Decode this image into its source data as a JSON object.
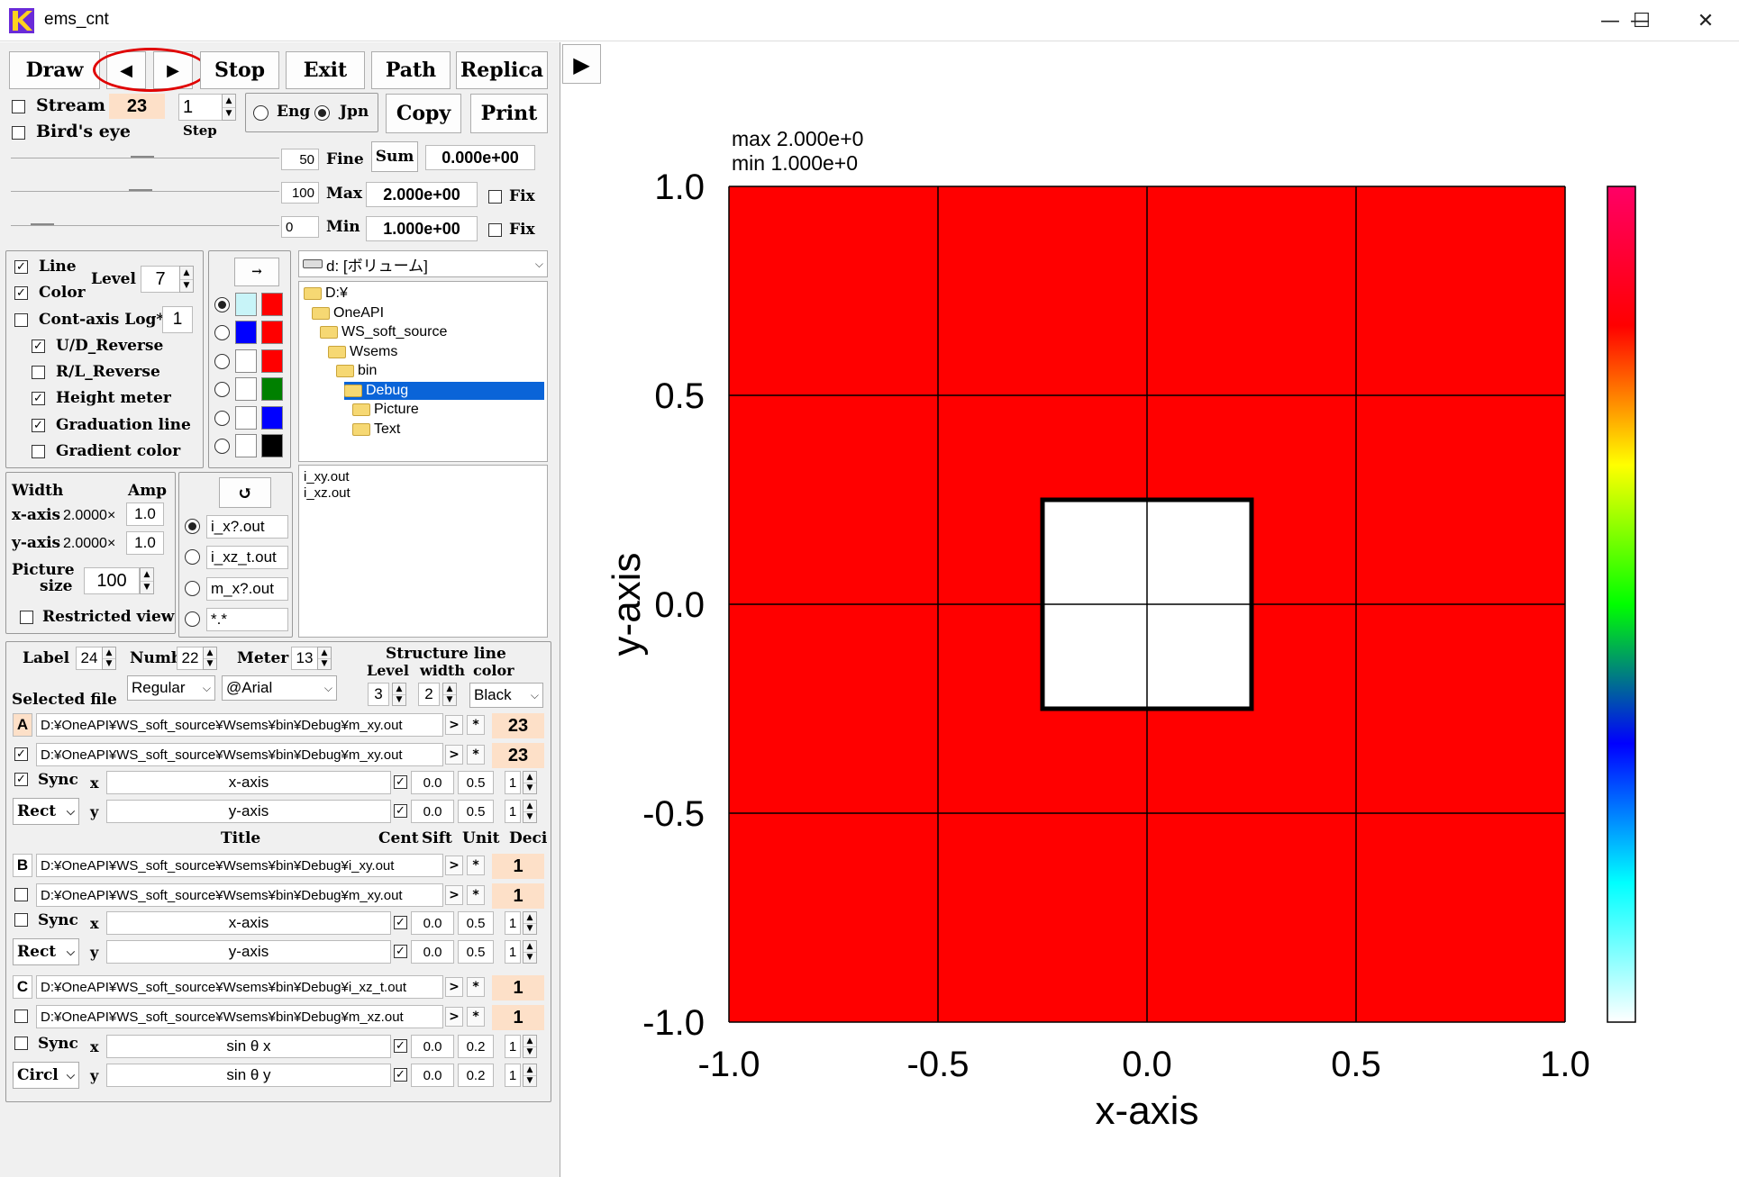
{
  "window": {
    "title": "ems_cnt",
    "minimize_icon": "—",
    "maximize_icon": "☐",
    "close_icon": "✕"
  },
  "toolbar": {
    "draw": "Draw",
    "prev": "◀",
    "next": "▶",
    "stop": "Stop",
    "exit": "Exit",
    "path": "Path",
    "replica": "Replica",
    "copy": "Copy",
    "print": "Print",
    "play": "▶"
  },
  "stream": {
    "label": "Stream",
    "value": "23",
    "step_value": "1",
    "step_label": "Step",
    "birds_eye": "Bird's eye"
  },
  "language": {
    "eng": "Eng",
    "jpn": "Jpn",
    "selected": "Jpn"
  },
  "range": {
    "fine_value": "50",
    "fine_label": "Fine",
    "sum_label": "Sum",
    "sum_value": "0.000e+00",
    "max_slider": "100",
    "max_label": "Max",
    "max_value": "2.000e+00",
    "max_fix": "Fix",
    "min_slider": "0",
    "min_label": "Min",
    "min_value": "1.000e+00",
    "min_fix": "Fix"
  },
  "options": {
    "line": "Line",
    "color": "Color",
    "level_label": "Level",
    "level_value": "7",
    "cont_axis": "Cont-axis Log*",
    "cont_axis_value": "1",
    "ud_reverse": "U/D_Reverse",
    "rl_reverse": "R/L_Reverse",
    "height_meter": "Height meter",
    "graduation_line": "Graduation line",
    "gradient_color": "Gradient color"
  },
  "palette": {
    "arrow": "→",
    "rows": [
      {
        "left": "#c8f4f8",
        "right": "#ff0000",
        "selected": true
      },
      {
        "left": "#0000ff",
        "right": "#ff0000",
        "selected": false
      },
      {
        "left": "#ffffff",
        "right": "#ff0000",
        "selected": false
      },
      {
        "left": "#ffffff",
        "right": "#008000",
        "selected": false
      },
      {
        "left": "#ffffff",
        "right": "#0000ff",
        "selected": false
      },
      {
        "left": "#ffffff",
        "right": "#000000",
        "selected": false
      }
    ]
  },
  "drive": {
    "value": "d: [ボリューム]"
  },
  "tree": [
    {
      "name": "D:¥",
      "indent": 0,
      "selected": false
    },
    {
      "name": "OneAPI",
      "indent": 1,
      "selected": false
    },
    {
      "name": "WS_soft_source",
      "indent": 2,
      "selected": false
    },
    {
      "name": "Wsems",
      "indent": 3,
      "selected": false
    },
    {
      "name": "bin",
      "indent": 4,
      "selected": false
    },
    {
      "name": "Debug",
      "indent": 5,
      "selected": true
    },
    {
      "name": "Picture",
      "indent": 6,
      "selected": false
    },
    {
      "name": "Text",
      "indent": 6,
      "selected": false
    }
  ],
  "files": [
    "i_xy.out",
    "i_xz.out"
  ],
  "size": {
    "width": "Width",
    "amp": "Amp",
    "xaxis": "x-axis",
    "x_mult": "2.0000×",
    "x_amp": "1.0",
    "yaxis": "y-axis",
    "y_mult": "2.0000×",
    "y_amp": "1.0",
    "picture_size_1": "Picture",
    "picture_size_2": "size",
    "picture_value": "100",
    "restricted": "Restricted view"
  },
  "patterns": {
    "refresh": "↺",
    "items": [
      {
        "label": "i_x?.out",
        "selected": true
      },
      {
        "label": "i_xz_t.out",
        "selected": false
      },
      {
        "label": "m_x?.out",
        "selected": false
      },
      {
        "label": "*.*",
        "selected": false
      }
    ]
  },
  "fonts": {
    "label": "Label",
    "label_value": "24",
    "numb": "Numb",
    "numb_value": "22",
    "meter": "Meter",
    "meter_value": "13",
    "style": "Regular",
    "face": "@Arial",
    "structure_line": "Structure line",
    "level": "Level",
    "width": "width",
    "color": "color",
    "level_value": "3",
    "width_value": "2",
    "color_value": "Black",
    "selected_file": "Selected file"
  },
  "groups": [
    {
      "letter": "A",
      "file1": "D:¥OneAPI¥WS_soft_source¥Wsems¥bin¥Debug¥m_xy.out",
      "val1": "23",
      "file2": "D:¥OneAPI¥WS_soft_source¥Wsems¥bin¥Debug¥m_xy.out",
      "val2": "23",
      "checked": true,
      "sync": "Sync",
      "sync_checked": true,
      "mode": "Rect",
      "x_title": "x-axis",
      "x_cent": "0.0",
      "x_sift": "0.5",
      "x_unit": "1",
      "y_title": "y-axis",
      "y_cent": "0.0",
      "y_sift": "0.5",
      "y_unit": "1"
    },
    {
      "letter": "B",
      "file1": "D:¥OneAPI¥WS_soft_source¥Wsems¥bin¥Debug¥i_xy.out",
      "val1": "1",
      "file2": "D:¥OneAPI¥WS_soft_source¥Wsems¥bin¥Debug¥m_xy.out",
      "val2": "1",
      "checked": false,
      "sync": "Sync",
      "sync_checked": false,
      "mode": "Rect",
      "x_title": "x-axis",
      "x_cent": "0.0",
      "x_sift": "0.5",
      "x_unit": "1",
      "y_title": "y-axis",
      "y_cent": "0.0",
      "y_sift": "0.5",
      "y_unit": "1"
    },
    {
      "letter": "C",
      "file1": "D:¥OneAPI¥WS_soft_source¥Wsems¥bin¥Debug¥i_xz_t.out",
      "val1": "1",
      "file2": "D:¥OneAPI¥WS_soft_source¥Wsems¥bin¥Debug¥m_xz.out",
      "val2": "1",
      "checked": false,
      "sync": "Sync",
      "sync_checked": false,
      "mode": "Circl",
      "x_title": "sin θ x",
      "x_cent": "0.0",
      "x_sift": "0.2",
      "x_unit": "1",
      "y_title": "sin θ y",
      "y_cent": "0.0",
      "y_sift": "0.2",
      "y_unit": "1"
    }
  ],
  "table_header": {
    "title": "Title",
    "cent": "Cent",
    "sift": "Sift",
    "unit": "Unit",
    "deci": "Deci"
  },
  "chart_data": {
    "type": "heatmap",
    "max_label": "max  2.000e+0",
    "min_label": "min   1.000e+0",
    "xlabel": "x-axis",
    "ylabel": "y-axis",
    "xlim": [
      -1.0,
      1.0
    ],
    "ylim": [
      -1.0,
      1.0
    ],
    "xticks": [
      "-1.0",
      "-0.5",
      "0.0",
      "0.5",
      "1.0"
    ],
    "yticks": [
      "1.0",
      "0.5",
      "0.0",
      "-0.5",
      "-1.0"
    ],
    "background_value": 2.0,
    "background_color": "#ff0000",
    "regions": [
      {
        "x": [
          -0.25,
          0.25
        ],
        "y": [
          -0.25,
          0.25
        ],
        "value": 1.0,
        "color": "#ffffff"
      }
    ],
    "grid": true,
    "colorbar": [
      "#ffffff",
      "#00ffff",
      "#0000ff",
      "#00ff00",
      "#ffff00",
      "#ff0000",
      "#ff0066"
    ]
  }
}
